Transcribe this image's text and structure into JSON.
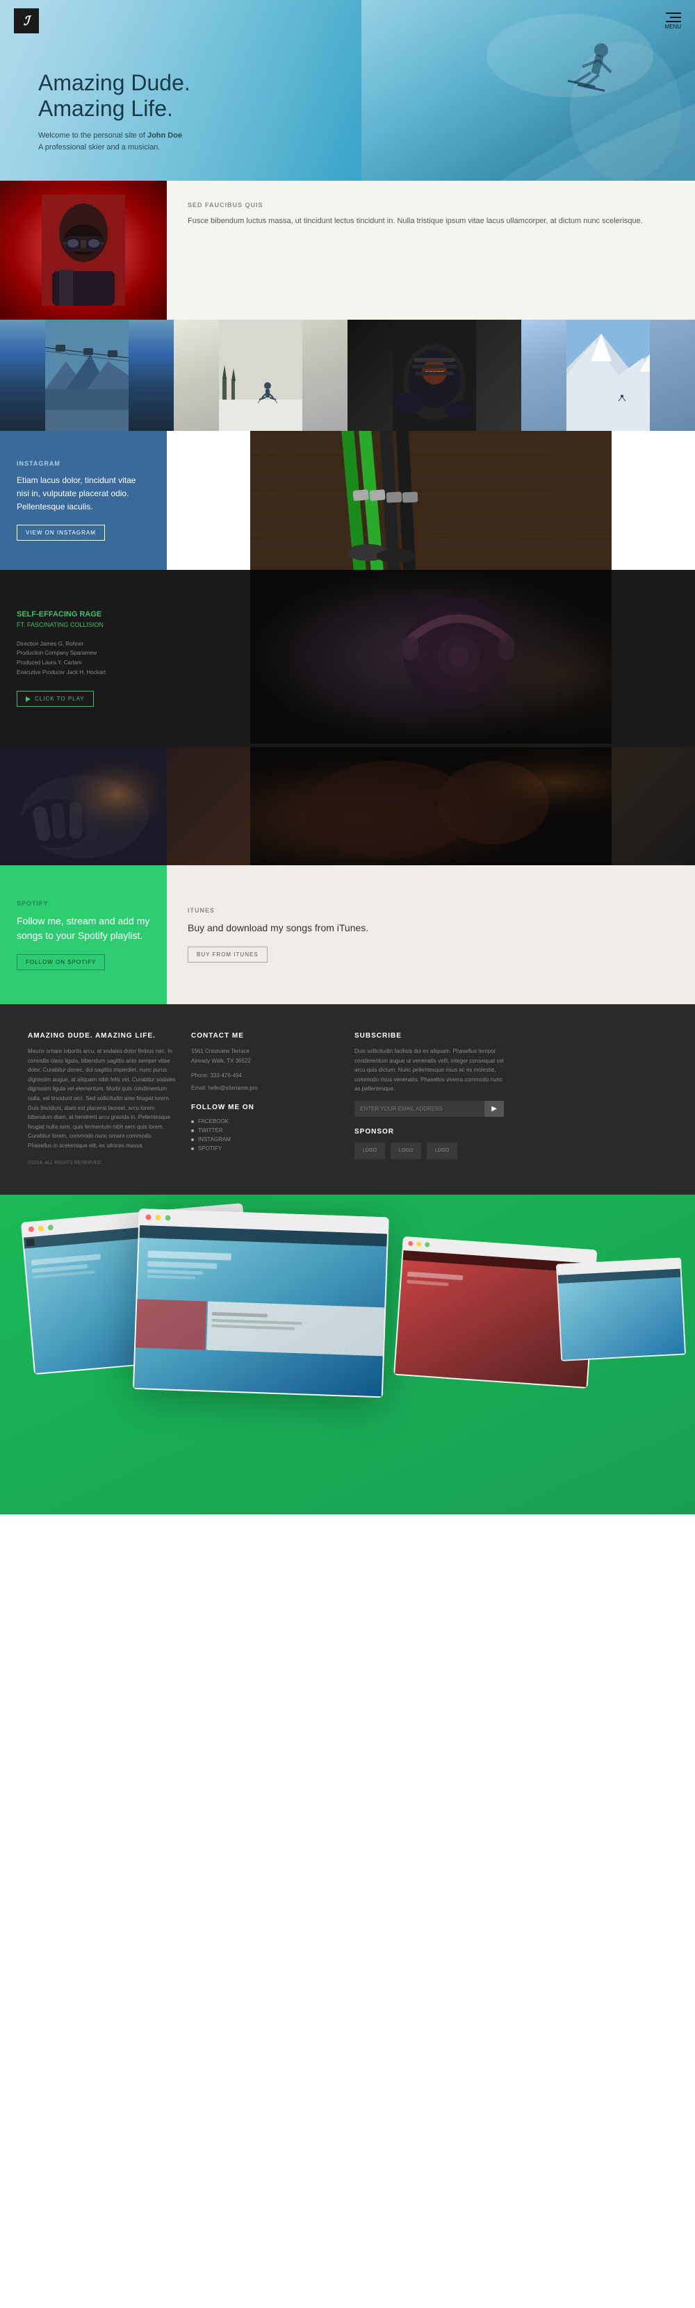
{
  "site": {
    "logo": "ℐ",
    "menu_label": "MENU"
  },
  "hero": {
    "title_line1": "Amazing Dude.",
    "title_line2": "Amazing Life.",
    "subtitle": "Welcome to the personal site of",
    "name": "John Doe",
    "description": "A professional skier and a musician."
  },
  "section2": {
    "label": "SED FAUCIBUS QUIS",
    "body": "Fusce bibendum luctus massa, ut tincidunt lectus tincidunt in. Nulla tristique ipsum vitae lacus ullamcorper, at dictum nunc scelerisque."
  },
  "instagram": {
    "label": "INSTAGRAM",
    "text": "Etiam lacus dolor, tincidunt vitae nisi in, vulputate placerat odio. Pellentesque iaculis.",
    "button": "VIEW ON INSTAGRAM"
  },
  "music": {
    "title": "SELF-EFFACING RAGE",
    "subtitle": "FT. FASCINATING COLLISION",
    "credits": [
      "Direction James G. Rohner",
      "Production Company Sparamew",
      "Produced Laura Y. Carlam",
      "Executive Producer Jack H. Hockart"
    ],
    "play_button": "CLICK TO PLAY"
  },
  "spotify": {
    "label": "SPOTIFY",
    "text": "Follow me, stream and add my songs to your Spotify playlist.",
    "button": "FOLLOW ON SPOTIFY"
  },
  "itunes": {
    "label": "ITUNES",
    "text": "Buy and download my songs from iTunes.",
    "button": "BUY FROM ITUNES"
  },
  "footer": {
    "brand_title": "AMAZING DUDE. AMAZING LIFE.",
    "brand_text": "Mauris ornare lobortis arcu, at sodales dolor finibus nec. In convallis class ligula, bibendum sagittis ante semper vitae dolor. Curabitur donec, dui sagittis imperdiet, nunc purus dignissim augue, at aliquam nibh felis vel. Curabitur sodales dignissim ligula vel elementum. Morbi quis condimentum nulla, vel tincidunt orci. Sed sollicitudin ante feugiat lorem. Duis tincidunt, diam est placerat laoreet, arcu lorem bibendum diam, at hendrerit arcu gravida in. Pellentesque feugiat nulla sem, quis fermentum nibh sem quis lorem. Curabitur lorem, commodo nunc ornare commodo. Phasellus in scelerisque elit, ex ultrices massa.",
    "copyright": "©2014, ALL RIGHTS RESERVED.",
    "contact_title": "CONTACT ME",
    "contact_address": "1561 Crestview Terrace\nAlready Walk, TX 36522",
    "contact_phone": "Phone: 333-476-494",
    "contact_email": "Email: hello@sitename.pro",
    "social_title": "FOLLOW ME ON",
    "social_links": [
      "FACEBOOK",
      "TWITTER",
      "INSTAGRAM",
      "SPOTIFY"
    ],
    "subscribe_title": "SUBSCRIBE",
    "subscribe_text": "Duis sollicitudin facilisis dui ex aliquam. Phasellus tempor condimentum augue ut venenatis velit, integer consequat vel arcu quis dictum. Nunc pellentesque risus ac ex molestie, commodo risus venenatis. Phasellus viverra commodo nunc as pellentesque.",
    "subscribe_placeholder": "ENTER YOUR EMAIL ADDRESS",
    "sponsor_title": "SPONSOR",
    "sponsor_logos": [
      "LOGO",
      "LOGO",
      "LOGO"
    ]
  }
}
